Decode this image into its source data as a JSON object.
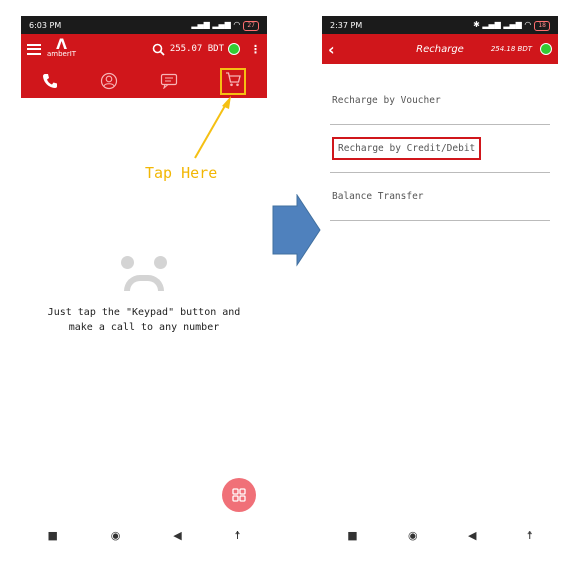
{
  "left": {
    "status": {
      "time": "6:03 PM",
      "battery": "27"
    },
    "header": {
      "logo_text": "amberIT",
      "balance": "255.07 BDT"
    },
    "annotation": "Tap Here",
    "empty_message_line1": "Just tap the \"Keypad\" button and",
    "empty_message_line2": "make a call to any number"
  },
  "right": {
    "status": {
      "time": "2:37 PM",
      "battery": "18"
    },
    "header": {
      "title": "Recharge",
      "balance": "254.18 BDT"
    },
    "menu": [
      {
        "label": "Recharge by Voucher"
      },
      {
        "label": "Recharge by Credit/Debit"
      },
      {
        "label": "Balance Transfer"
      }
    ]
  },
  "colors": {
    "brand_red": "#d0161b",
    "highlight_yellow": "#f5c013",
    "arrow_blue": "#4f81bd",
    "online_green": "#33cc33"
  }
}
